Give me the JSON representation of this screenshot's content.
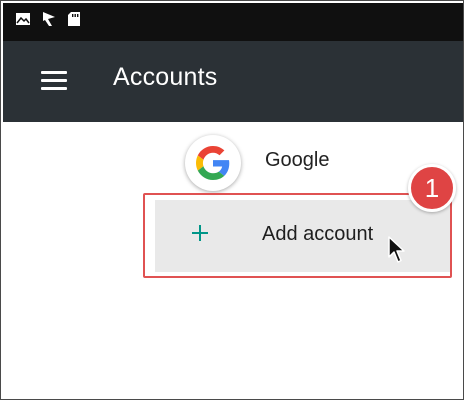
{
  "status_bar": {
    "icons": [
      "gallery-icon",
      "flag-icon",
      "sd-card-icon"
    ]
  },
  "app_bar": {
    "menu_icon": "hamburger-menu-icon",
    "title": "Accounts"
  },
  "accounts": {
    "items": [
      {
        "label": "Google",
        "icon": "google-g-icon"
      }
    ],
    "add_account": {
      "label": "Add account",
      "icon": "plus-icon"
    }
  },
  "annotation": {
    "step_number": "1",
    "highlight_color": "#e05252"
  },
  "colors": {
    "status_bar": "#101010",
    "app_bar": "#2b3136",
    "accent": "#009688",
    "row_highlight": "#e9e9e9"
  }
}
